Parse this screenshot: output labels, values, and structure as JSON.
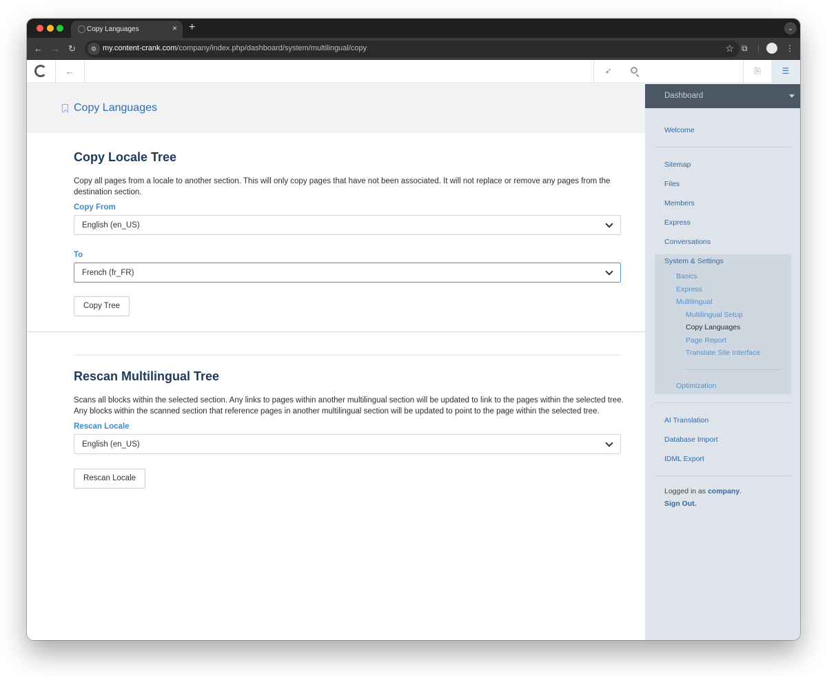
{
  "browser": {
    "tab_title": "Copy Languages",
    "tab_close": "×",
    "new_tab": "+",
    "url_host": "my.content-crank.com",
    "url_path": "/company/index.php/dashboard/system/multilingual/copy"
  },
  "cms": {
    "search_placeholder": ""
  },
  "page": {
    "title": "Copy Languages",
    "copy_section": {
      "heading": "Copy Locale Tree",
      "description": "Copy all pages from a locale to another section. This will only copy pages that have not been associated. It will not replace or remove any pages from the destination section.",
      "from_label": "Copy From",
      "from_value": "English (en_US)",
      "to_label": "To",
      "to_value": "French (fr_FR)",
      "button": "Copy Tree"
    },
    "rescan_section": {
      "heading": "Rescan Multilingual Tree",
      "description": "Scans all blocks within the selected section. Any links to pages within another multilingual section will be updated to link to the pages within the selected tree. Any blocks within the scanned section that reference pages in another multilingual section will be updated to point to the page within the selected tree.",
      "locale_label": "Rescan Locale",
      "locale_value": "English (en_US)",
      "button": "Rescan Locale"
    }
  },
  "sidebar": {
    "header": "Dashboard",
    "welcome": "Welcome",
    "items": [
      "Sitemap",
      "Files",
      "Members",
      "Express",
      "Conversations"
    ],
    "system_settings": "System & Settings",
    "system_children": [
      "Basics",
      "Express",
      "Multilingual"
    ],
    "multilingual_children": [
      "Multilingual Setup",
      "Copy Languages",
      "Page Report",
      "Translate Site Interface"
    ],
    "optimization": "Optimization",
    "extras": [
      "AI Translation",
      "Database Import",
      "IDML Export"
    ],
    "logged_in_prefix": "Logged in as",
    "user": "company",
    "logged_in_suffix": ".",
    "sign_out": "Sign Out."
  }
}
